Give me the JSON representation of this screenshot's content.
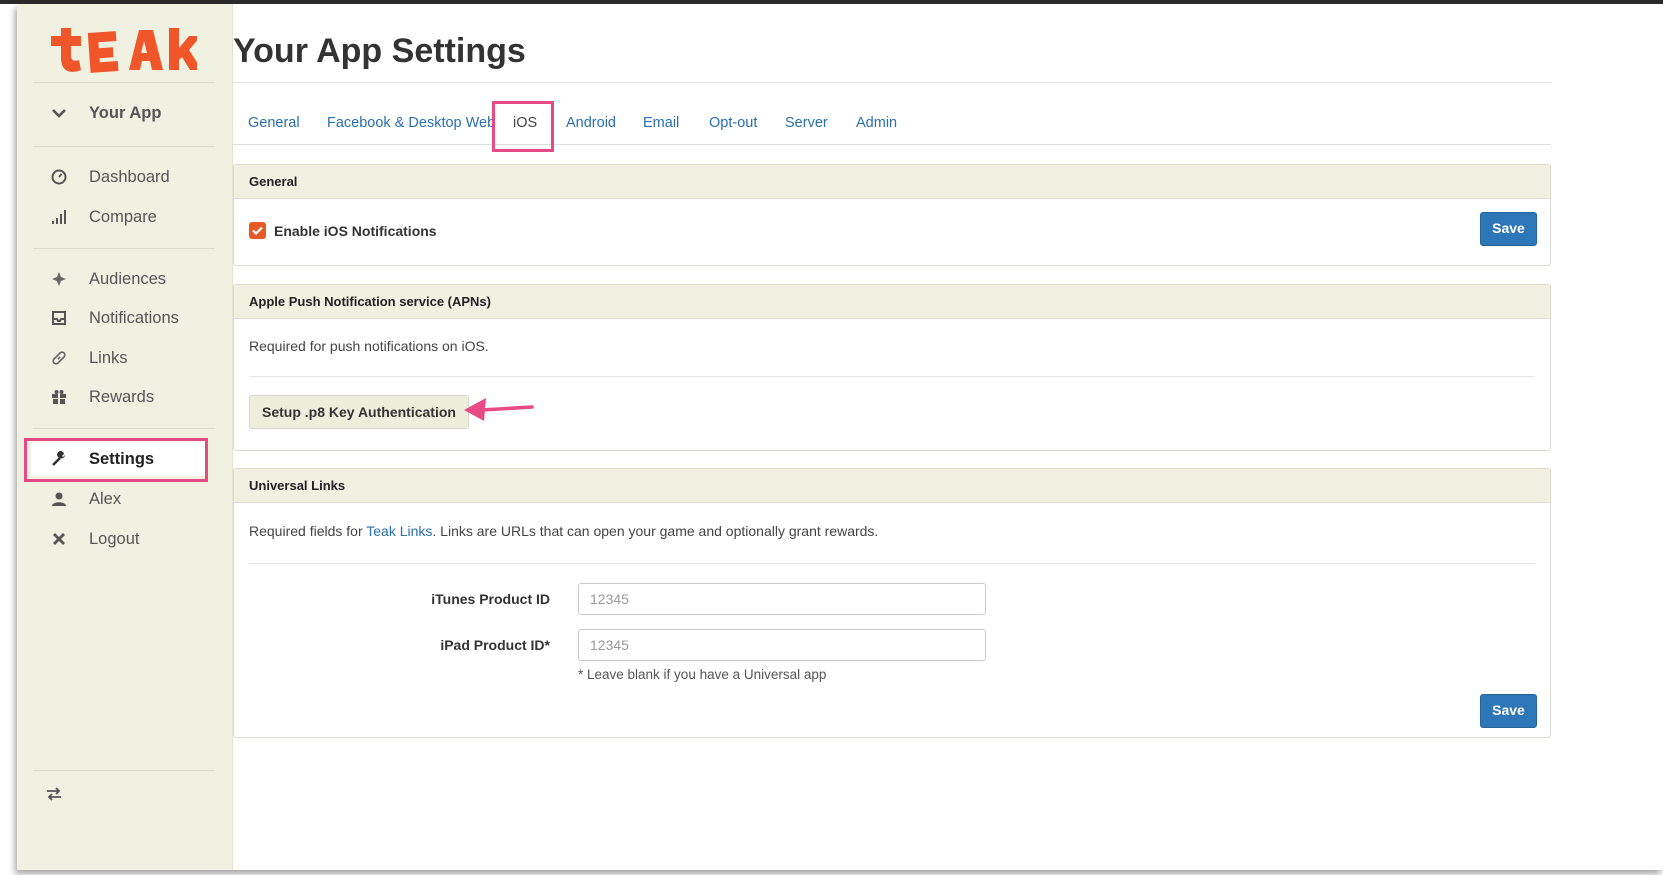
{
  "brand": {
    "logo_text": "teak",
    "logo_color": "#f0562a"
  },
  "sidebar": {
    "app_label": "Your App",
    "items": [
      {
        "label": "Dashboard",
        "icon": "dashboard-icon"
      },
      {
        "label": "Compare",
        "icon": "bar-chart-icon"
      },
      {
        "label": "Audiences",
        "icon": "audiences-icon"
      },
      {
        "label": "Notifications",
        "icon": "inbox-icon"
      },
      {
        "label": "Links",
        "icon": "link-icon"
      },
      {
        "label": "Rewards",
        "icon": "gift-icon"
      },
      {
        "label": "Settings",
        "icon": "wrench-icon"
      },
      {
        "label": "Alex",
        "icon": "user-icon"
      },
      {
        "label": "Logout",
        "icon": "close-icon"
      }
    ],
    "active": "Settings"
  },
  "page": {
    "title": "Your App Settings"
  },
  "tabs": [
    "General",
    "Facebook & Desktop Web",
    "iOS",
    "Android",
    "Email",
    "Opt-out",
    "Server",
    "Admin"
  ],
  "active_tab": "iOS",
  "general_panel": {
    "header": "General",
    "checkbox_label": "Enable iOS Notifications",
    "checked": true,
    "save_label": "Save"
  },
  "apns_panel": {
    "header": "Apple Push Notification service (APNs)",
    "description": "Required for push notifications on iOS.",
    "setup_button": "Setup .p8 Key Authentication"
  },
  "universal_links_panel": {
    "header": "Universal Links",
    "desc_prefix": "Required fields for ",
    "desc_link": "Teak Links",
    "desc_suffix": ". Links are URLs that can open your game and optionally grant rewards.",
    "itunes_label": "iTunes Product ID",
    "itunes_placeholder": "12345",
    "ipad_label": "iPad Product ID*",
    "ipad_placeholder": "12345",
    "ipad_help": "* Leave blank if you have a Universal app",
    "save_label": "Save"
  },
  "colors": {
    "accent_blue": "#2d76b7",
    "highlight_pink": "#e84a86",
    "sidebar_bg": "#f1f1e2"
  }
}
